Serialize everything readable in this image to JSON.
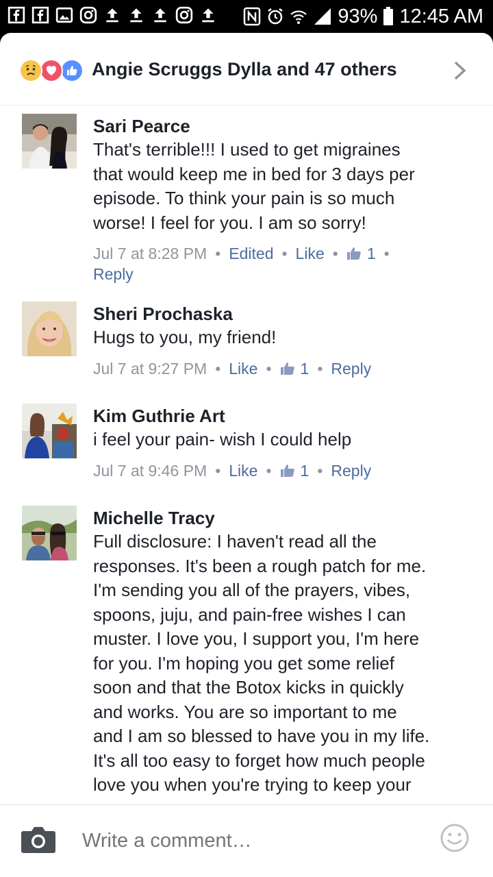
{
  "status_bar": {
    "battery": "93%",
    "time": "12:45 AM",
    "left_icons": [
      "facebook-icon",
      "facebook-icon",
      "gallery-icon",
      "instagram-icon",
      "upload-icon",
      "upload-icon",
      "upload-icon",
      "instagram-icon",
      "upload-icon"
    ],
    "right_icons": [
      "nfc-icon",
      "alarm-icon",
      "wifi-icon",
      "signal-icon",
      "battery-icon"
    ]
  },
  "reactions": {
    "summary": "Angie Scruggs Dylla and 47 others",
    "icons": [
      "sad-reaction-icon",
      "love-reaction-icon",
      "like-reaction-icon"
    ]
  },
  "comments": [
    {
      "name": "Sari Pearce",
      "lines": [
        "That's terrible!!!  I used to get migraines",
        "that would keep me in bed for 3 days per",
        "episode. To think your pain is so much",
        "worse! I feel for you. I am so sorry!"
      ],
      "time": "Jul 7 at 8:28 PM",
      "edited": "Edited",
      "like": "Like",
      "likes": "1",
      "reply": "Reply"
    },
    {
      "name": "Sheri Prochaska",
      "lines": [
        "Hugs to you, my friend!"
      ],
      "time": "Jul 7 at 9:27 PM",
      "like": "Like",
      "likes": "1",
      "reply": "Reply"
    },
    {
      "name": "Kim Guthrie Art",
      "lines": [
        "i feel your pain- wish I could help"
      ],
      "time": "Jul 7 at 9:46 PM",
      "like": "Like",
      "likes": "1",
      "reply": "Reply"
    },
    {
      "name": "Michelle Tracy",
      "lines": [
        "Full disclosure: I haven't read all the",
        "responses. It's been a rough patch for me.",
        "I'm sending you all of the prayers, vibes,",
        "spoons, juju, and pain-free wishes I can",
        "muster. I love you, I support you, I'm here",
        "for you. I'm hoping you get some relief",
        "soon and that the Botox kicks in quickly",
        "and works. You are so important to me",
        "and I am so blessed to have you in my life.",
        "It's all too easy to forget how much people",
        "love you when you're trying to keep your"
      ]
    }
  ],
  "composer": {
    "placeholder": "Write a comment…"
  },
  "colors": {
    "link": "#4b6c9f",
    "meta": "#90949c",
    "text": "#1d2129",
    "like_blue": "#5890ff",
    "love_red": "#f25268"
  }
}
